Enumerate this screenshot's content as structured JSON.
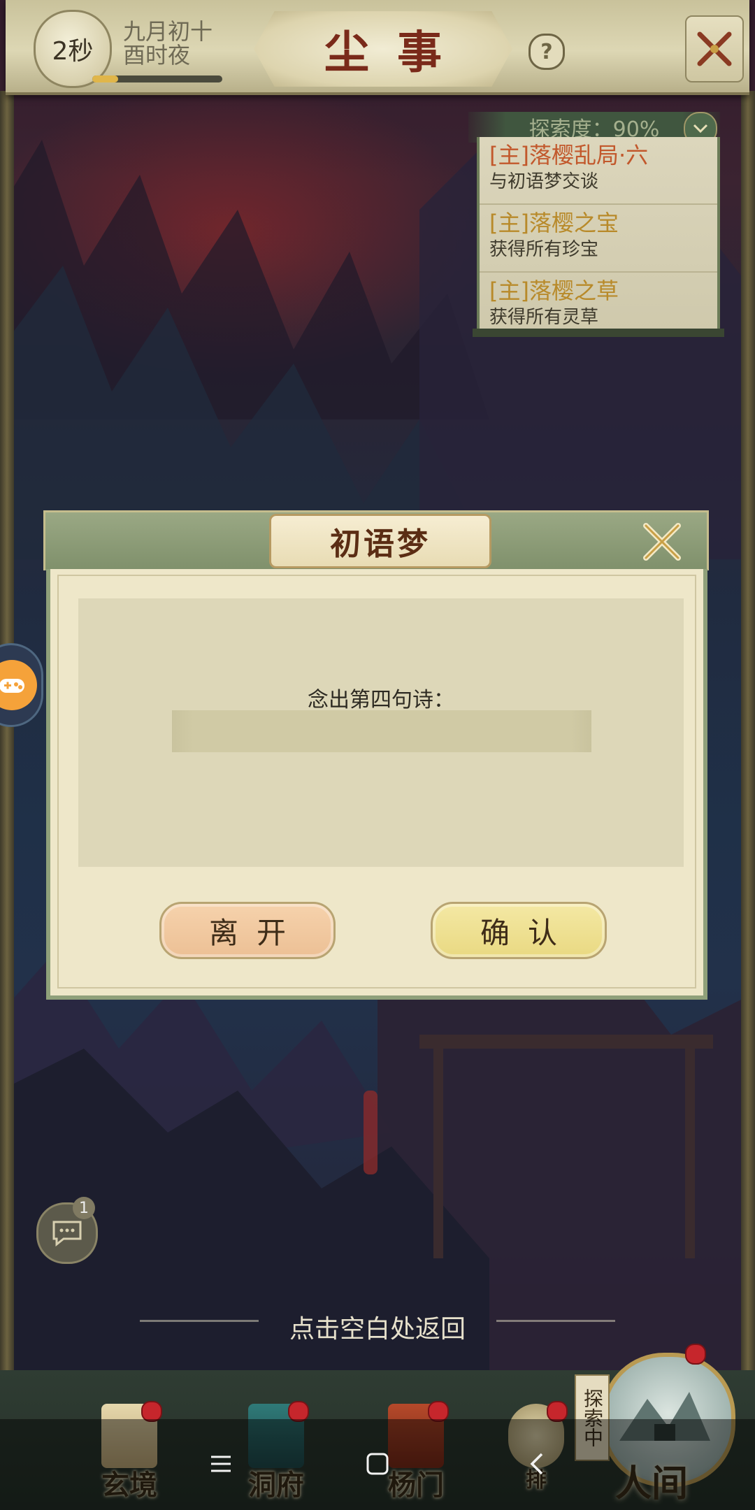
{
  "header": {
    "timer": "2秒",
    "date_line1": "九月初十",
    "date_line2": "酉时夜",
    "title": "尘事",
    "help_label": "?",
    "time_progress": 0.2
  },
  "quest_panel": {
    "exploration": "探索度：90%",
    "items": [
      {
        "title": "[主]落樱乱局·六",
        "desc": "与初语梦交谈",
        "color": "#c2582c"
      },
      {
        "title": "[主]落樱之宝",
        "desc": "获得所有珍宝",
        "color": "#b88a2a"
      },
      {
        "title": "[主]落樱之草",
        "desc": "获得所有灵草",
        "color": "#b88a2a"
      }
    ]
  },
  "dialog": {
    "title": "初语梦",
    "prompt": "念出第四句诗：",
    "input_value": "",
    "input_placeholder": "",
    "leave_label": "离开",
    "confirm_label": "确认"
  },
  "chat": {
    "badge": "1"
  },
  "return_hint": "点击空白处返回",
  "bottom_nav": {
    "items": [
      {
        "label": "玄境",
        "icon": "scroll-icon"
      },
      {
        "label": "洞府",
        "icon": "pavilion-icon"
      },
      {
        "label": "杨门",
        "icon": "banner-icon"
      },
      {
        "label": "排",
        "icon": "ranking-icon"
      }
    ],
    "explore_tag": "探索中",
    "world_label": "人间"
  },
  "system_nav": {
    "menu": "menu-icon",
    "home": "home-icon",
    "back": "back-icon"
  },
  "colors": {
    "accent_red": "#c6262c",
    "dialog_green": "#8fa07a",
    "dialog_bg": "#eee7c9"
  }
}
